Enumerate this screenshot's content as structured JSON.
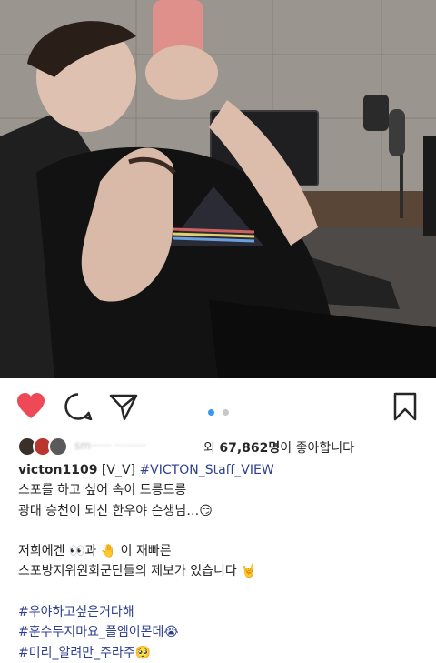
{
  "colors": {
    "heart": "#ed4956",
    "hashtag": "#2e3f8f",
    "text": "#262626",
    "dot_active": "#3897f0",
    "dot_inactive": "#c7c7c7"
  },
  "post": {
    "image_alt": "person reclining in a chair looking at a phone",
    "carousel": {
      "count": 2,
      "active": 1
    }
  },
  "likes": {
    "blurred_names": "sm······ ·········",
    "prefix": "외",
    "count": "67,862명",
    "suffix": "이 좋아합니다"
  },
  "caption": {
    "username": "victon1109",
    "first_text": "[V_V]",
    "first_tag": "#VICTON_Staff_VIEW",
    "line2": "스포를 하고 싶어 속이 드릉드릉",
    "line3": "광대 승천이 되신 한우야 슨생님…😏",
    "line5": "저희에겐 👀과 🤚 이 재빠른",
    "line6": "스포방지위원회군단들의 제보가 있습니다 🤘",
    "tag1": "#우야하고싶은거다해",
    "tag2": "#훈수두지마요_플엠이몬데😭",
    "tag3": "#미리_알려만_주라주🥺"
  }
}
